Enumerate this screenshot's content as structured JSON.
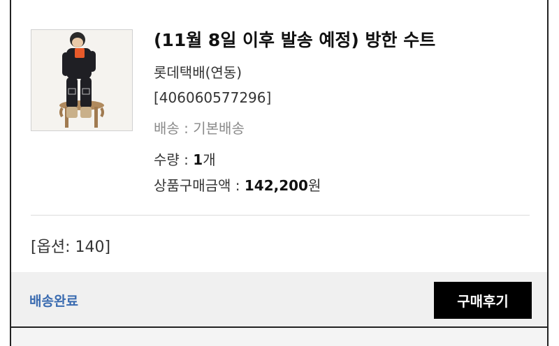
{
  "order": {
    "product_title": "(11월 8일 이후 발송 예정) 방한 수트",
    "carrier": "롯데택배(연동)",
    "tracking_number": "[406060577296]",
    "shipping_label": "배송 : 기본배송",
    "quantity_prefix": "수량 : ",
    "quantity_value": "1",
    "quantity_unit": "개",
    "amount_prefix": "상품구매금액 : ",
    "amount_value": "142,200",
    "amount_unit": "원",
    "option_text": "[옵션: 140]",
    "thumbnail_icon": "product-photo-snowsuit-child"
  },
  "footer": {
    "status_label": "배송완료",
    "review_button_label": "구매후기"
  },
  "colors": {
    "status_link": "#3a6bb0",
    "review_button_bg": "#000000",
    "footer_bg": "#f0f0f0"
  }
}
